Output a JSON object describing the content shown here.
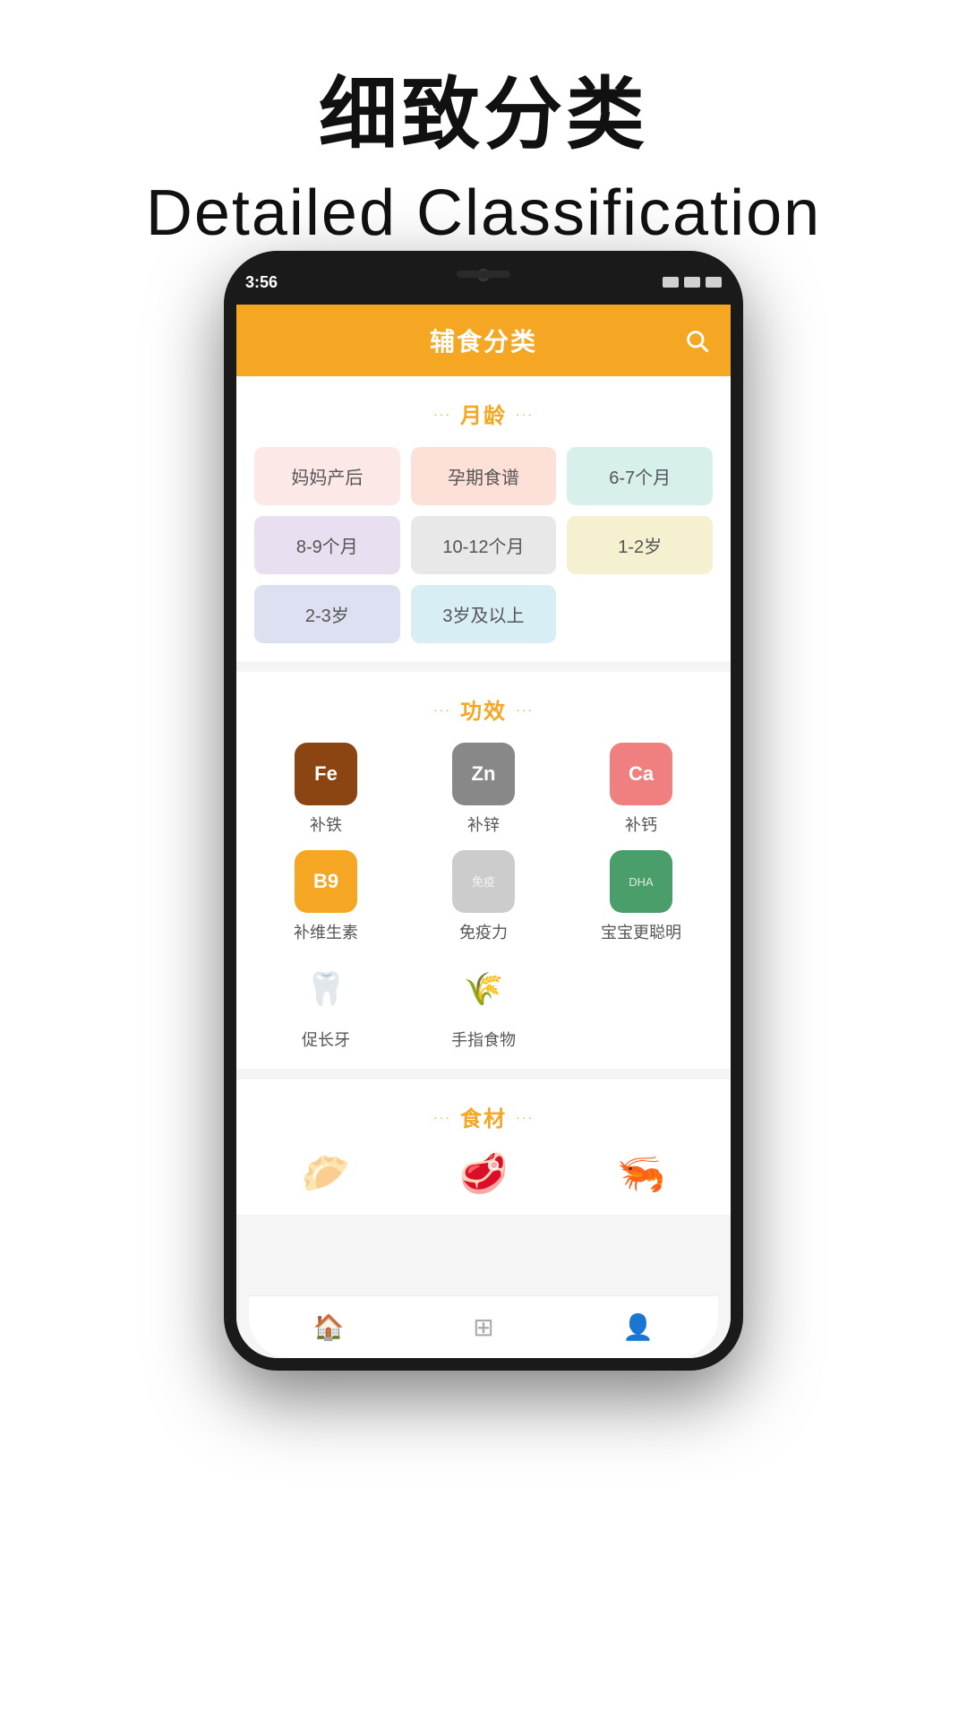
{
  "page": {
    "title_zh": "细致分类",
    "title_en": "Detailed Classification"
  },
  "app": {
    "header_title": "辅食分类",
    "status_time": "3:56"
  },
  "section_age": {
    "title": "月龄",
    "dots": "···",
    "tags": [
      {
        "label": "妈妈产后",
        "color_class": "tag-pink"
      },
      {
        "label": "孕期食谱",
        "color_class": "tag-salmon"
      },
      {
        "label": "6-7个月",
        "color_class": "tag-teal"
      },
      {
        "label": "8-9个月",
        "color_class": "tag-purple"
      },
      {
        "label": "10-12个月",
        "color_class": "tag-gray"
      },
      {
        "label": "1-2岁",
        "color_class": "tag-yellow"
      },
      {
        "label": "2-3岁",
        "color_class": "tag-lavender"
      },
      {
        "label": "3岁及以上",
        "color_class": "tag-cyan"
      }
    ]
  },
  "section_function": {
    "title": "功效",
    "dots": "···",
    "items": [
      {
        "icon_text": "Fe",
        "label": "补铁",
        "icon_class": "func-icon-fe"
      },
      {
        "icon_text": "Zn",
        "label": "补锌",
        "icon_class": "func-icon-zn"
      },
      {
        "icon_text": "Ca",
        "label": "补钙",
        "icon_class": "func-icon-ca"
      },
      {
        "icon_text": "B9",
        "label": "补维生素",
        "icon_class": "func-icon-b9"
      },
      {
        "icon_text": "免疫",
        "label": "免疫力",
        "icon_class": "func-icon-immune"
      },
      {
        "icon_text": "DHA",
        "label": "宝宝更聪明",
        "icon_class": "func-icon-dha"
      },
      {
        "icon_emoji": "🦷",
        "label": "促长牙",
        "icon_class": "func-icon-tooth"
      },
      {
        "icon_emoji": "🌾",
        "label": "手指食物",
        "icon_class": "func-icon-finger"
      }
    ]
  },
  "section_food": {
    "title": "食材",
    "dots": "···",
    "items": [
      {
        "emoji": "🥟",
        "label": ""
      },
      {
        "emoji": "🥩",
        "label": ""
      },
      {
        "emoji": "🦐",
        "label": ""
      }
    ]
  },
  "bottom_nav": {
    "items": [
      {
        "icon": "🏠",
        "active": true
      },
      {
        "icon": "⊞",
        "active": false
      },
      {
        "icon": "👤",
        "active": false
      }
    ]
  }
}
